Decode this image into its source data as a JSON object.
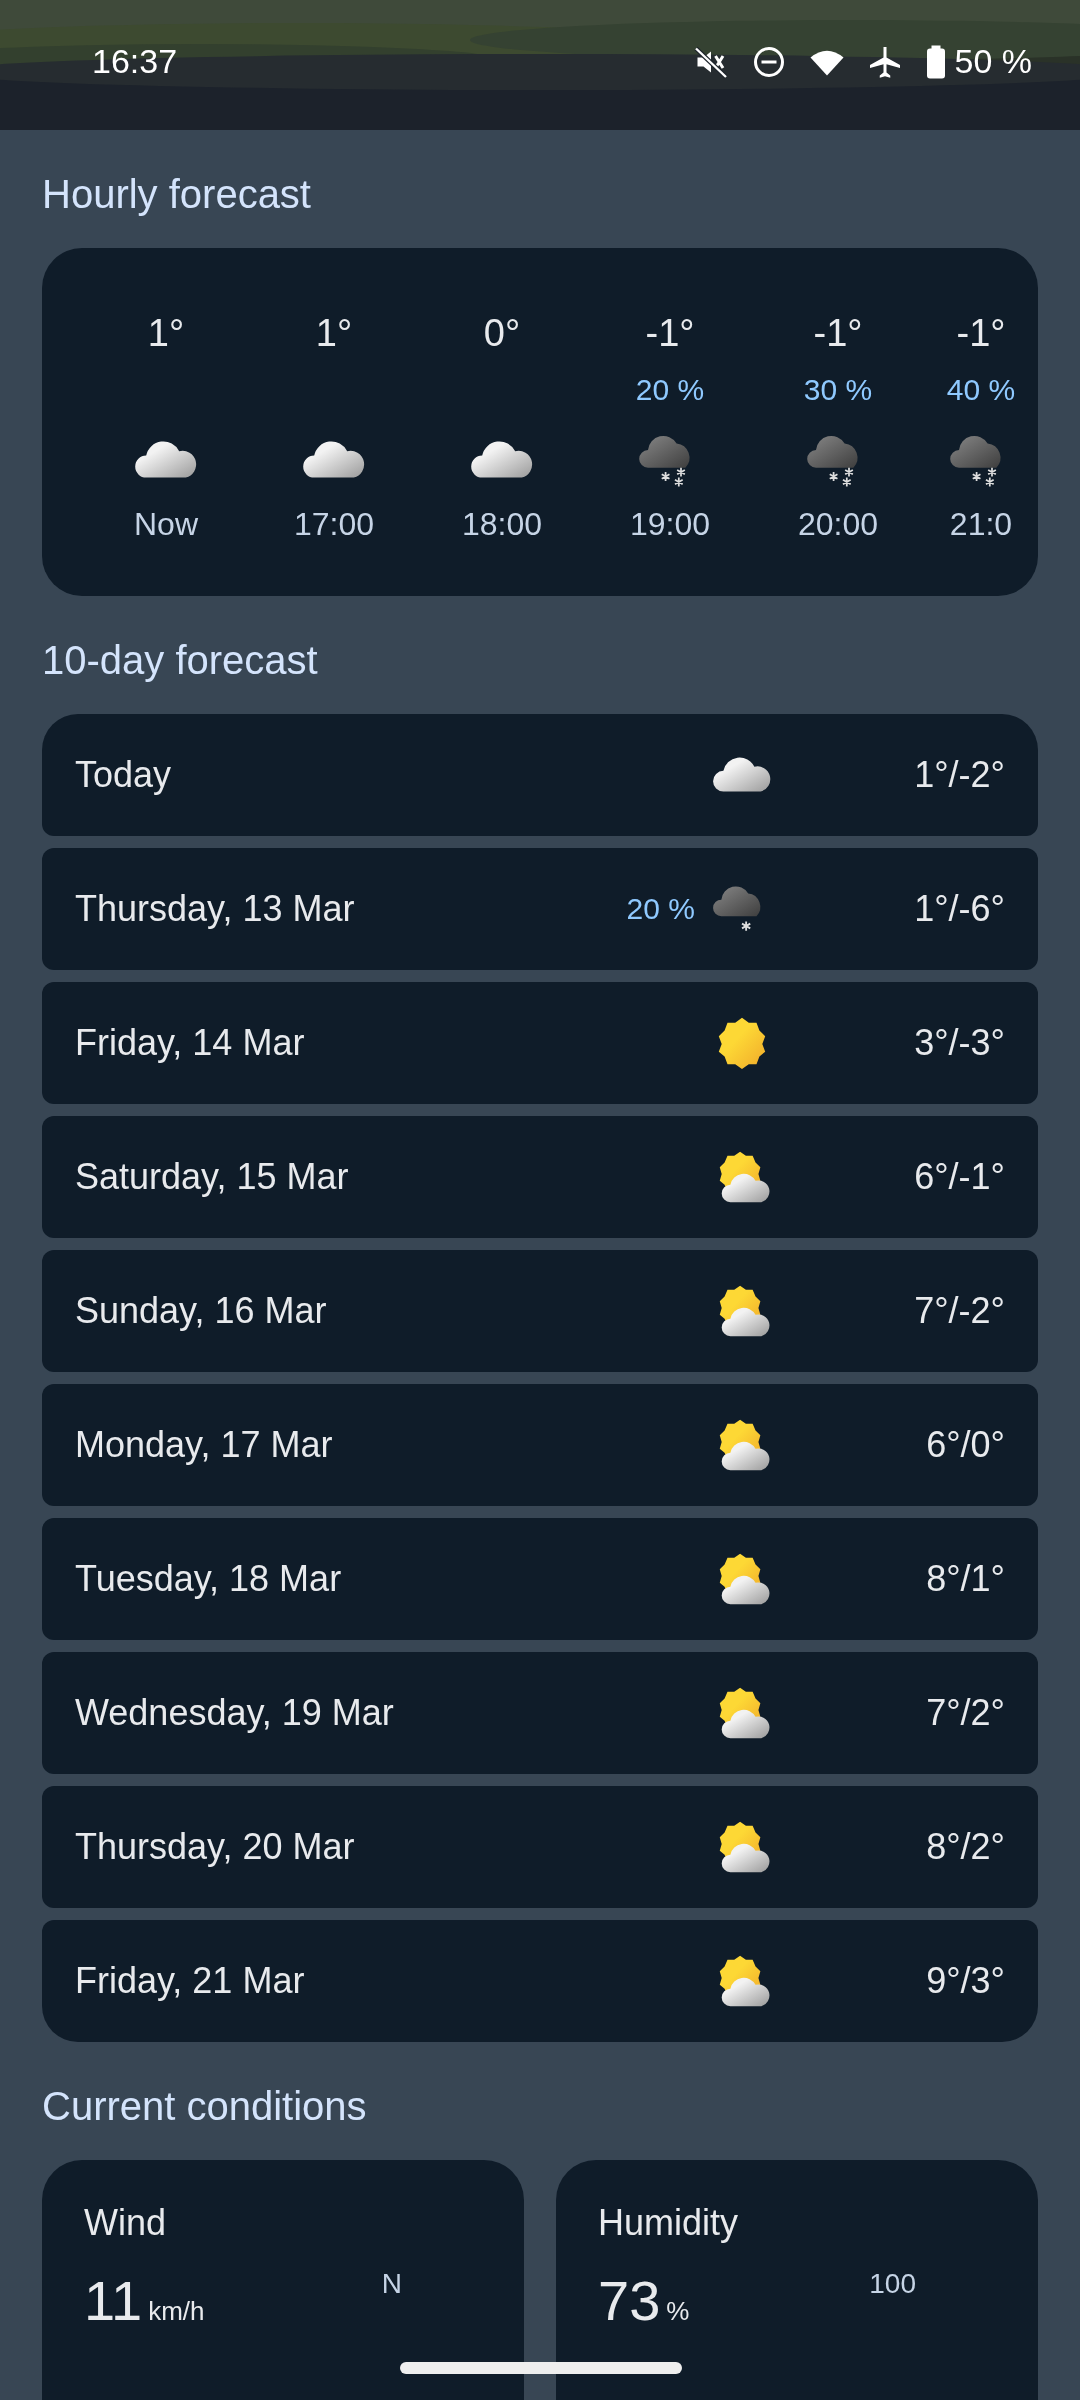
{
  "status_bar": {
    "time": "16:37",
    "battery": "50 %"
  },
  "hourly": {
    "title": "Hourly forecast",
    "items": [
      {
        "temp": "1°",
        "kind": "cloudy",
        "time": "Now"
      },
      {
        "temp": "1°",
        "kind": "cloudy",
        "time": "17:00"
      },
      {
        "temp": "0°",
        "kind": "cloudy",
        "time": "18:00"
      },
      {
        "temp": "-1°",
        "precip": "20 %",
        "kind": "snow",
        "time": "19:00"
      },
      {
        "temp": "-1°",
        "precip": "30 %",
        "kind": "snow",
        "time": "20:00"
      },
      {
        "temp": "-1°",
        "precip": "40 %",
        "kind": "snow",
        "time": "21:0"
      }
    ]
  },
  "daily": {
    "title": "10-day forecast",
    "items": [
      {
        "day": "Today",
        "kind": "cloudy",
        "temps": "1°/-2°"
      },
      {
        "day": "Thursday, 13 Mar",
        "precip": "20 %",
        "kind": "light_snow",
        "temps": "1°/-6°"
      },
      {
        "day": "Friday, 14 Mar",
        "kind": "sunny",
        "temps": "3°/-3°"
      },
      {
        "day": "Saturday, 15 Mar",
        "kind": "partly_cloudy",
        "temps": "6°/-1°"
      },
      {
        "day": "Sunday, 16 Mar",
        "kind": "partly_cloudy",
        "temps": "7°/-2°"
      },
      {
        "day": "Monday, 17 Mar",
        "kind": "partly_cloudy",
        "temps": "6°/0°"
      },
      {
        "day": "Tuesday, 18 Mar",
        "kind": "partly_cloudy",
        "temps": "8°/1°"
      },
      {
        "day": "Wednesday, 19 Mar",
        "kind": "partly_cloudy",
        "temps": "7°/2°"
      },
      {
        "day": "Thursday, 20 Mar",
        "kind": "partly_cloudy",
        "temps": "8°/2°"
      },
      {
        "day": "Friday, 21 Mar",
        "kind": "partly_cloudy",
        "temps": "9°/3°"
      }
    ]
  },
  "current_conditions": {
    "title": "Current conditions",
    "wind": {
      "title": "Wind",
      "value": "11",
      "unit": "km/h",
      "compass": "N"
    },
    "humidity": {
      "title": "Humidity",
      "value": "73",
      "unit": "%",
      "scale_max": "100"
    }
  }
}
